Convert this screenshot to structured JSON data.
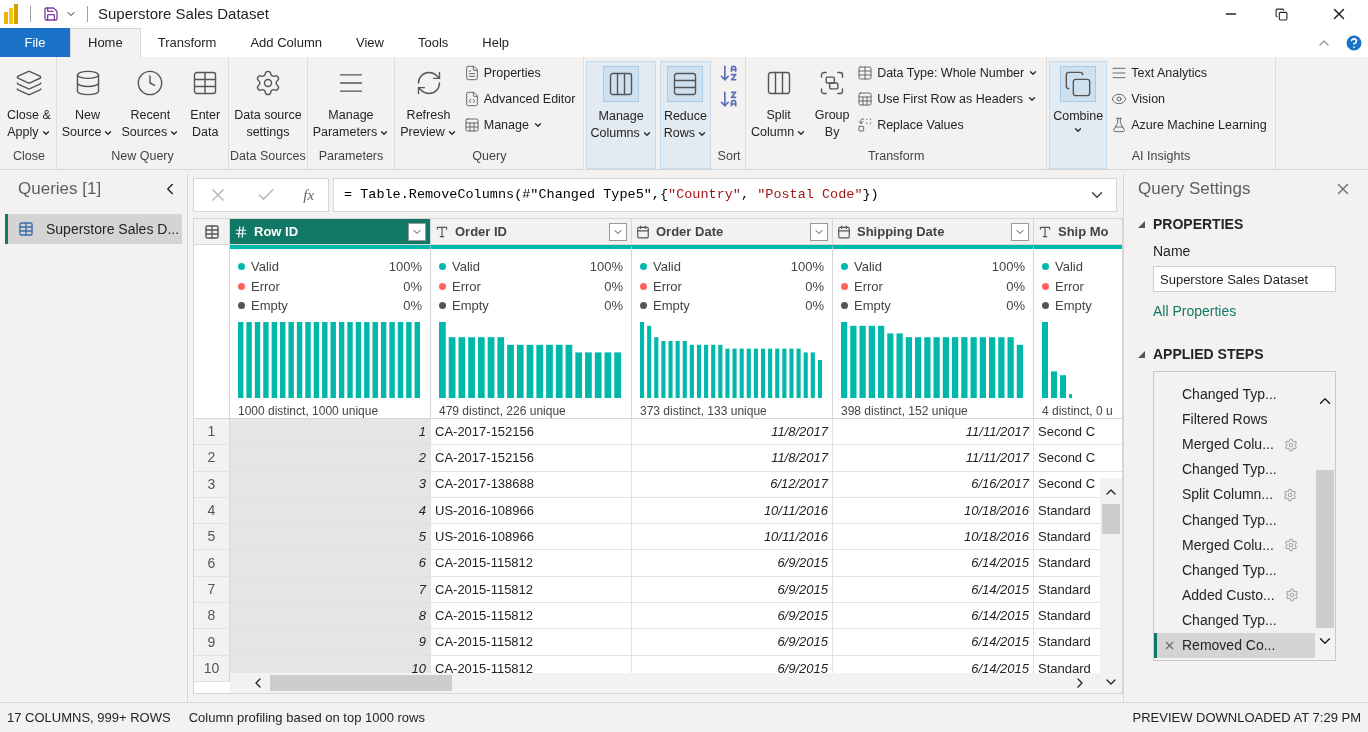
{
  "title_bar": {
    "title": "Superstore Sales Dataset"
  },
  "menu_tabs": [
    {
      "label": "File",
      "kind": "file",
      "selected": false
    },
    {
      "label": "Home",
      "kind": "tab",
      "selected": true
    },
    {
      "label": "Transform",
      "kind": "tab",
      "selected": false
    },
    {
      "label": "Add Column",
      "kind": "tab",
      "selected": false
    },
    {
      "label": "View",
      "kind": "tab",
      "selected": false
    },
    {
      "label": "Tools",
      "kind": "tab",
      "selected": false
    },
    {
      "label": "Help",
      "kind": "tab",
      "selected": false
    }
  ],
  "ribbon": [
    {
      "label": "Close",
      "items": [
        {
          "kind": "large",
          "lines": [
            "Close &",
            "Apply"
          ],
          "dropdown": true,
          "highlighted": false
        }
      ]
    },
    {
      "label": "New Query",
      "items": [
        {
          "kind": "large",
          "lines": [
            "New",
            "Source"
          ],
          "dropdown": true,
          "highlighted": false
        },
        {
          "kind": "large",
          "lines": [
            "Recent",
            "Sources"
          ],
          "dropdown": true,
          "highlighted": false
        },
        {
          "kind": "large",
          "lines": [
            "Enter",
            "Data"
          ],
          "dropdown": false,
          "highlighted": false
        }
      ]
    },
    {
      "label": "Data Sources",
      "items": [
        {
          "kind": "large",
          "lines": [
            "Data source",
            "settings"
          ],
          "dropdown": false,
          "highlighted": false
        }
      ]
    },
    {
      "label": "Parameters",
      "items": [
        {
          "kind": "large",
          "lines": [
            "Manage",
            "Parameters"
          ],
          "dropdown": true,
          "highlighted": false
        }
      ]
    },
    {
      "label": "Query",
      "items": [
        {
          "kind": "large",
          "lines": [
            "Refresh",
            "Preview"
          ],
          "dropdown": true,
          "highlighted": false
        },
        {
          "kind": "small",
          "lines": [
            "Properties"
          ],
          "dropdown": false
        },
        {
          "kind": "small",
          "lines": [
            "Advanced Editor"
          ],
          "dropdown": false
        },
        {
          "kind": "small",
          "lines": [
            "Manage"
          ],
          "dropdown": true
        }
      ]
    },
    {
      "items": [
        {
          "kind": "large",
          "lines": [
            "Manage",
            "Columns"
          ],
          "dropdown": true,
          "highlighted": true
        }
      ]
    },
    {
      "items": [
        {
          "kind": "large",
          "lines": [
            "Reduce",
            "Rows"
          ],
          "dropdown": true,
          "highlighted": true
        }
      ]
    },
    {
      "label": "Sort",
      "items": [
        {
          "kind": "icon"
        },
        {
          "kind": "icon"
        }
      ]
    },
    {
      "label": "Transform",
      "items": [
        {
          "kind": "large",
          "lines": [
            "Split",
            "Column"
          ],
          "dropdown": true,
          "highlighted": false
        },
        {
          "kind": "large",
          "lines": [
            "Group",
            "By"
          ],
          "dropdown": false,
          "highlighted": false
        },
        {
          "kind": "small",
          "lines": [
            "Data Type: Whole Number"
          ],
          "dropdown": true
        },
        {
          "kind": "small",
          "lines": [
            "Use First Row as Headers"
          ],
          "dropdown": true
        },
        {
          "kind": "small",
          "lines": [
            "Replace Values"
          ],
          "dropdown": false
        }
      ]
    },
    {
      "label": "AI Insights",
      "items": [
        {
          "kind": "large",
          "lines": [
            "Combine"
          ],
          "dropdown": true,
          "highlighted": true
        },
        {
          "kind": "small",
          "lines": [
            "Text Analytics"
          ],
          "dropdown": false
        },
        {
          "kind": "small",
          "lines": [
            "Vision"
          ],
          "dropdown": false
        },
        {
          "kind": "small",
          "lines": [
            "Azure Machine Learning"
          ],
          "dropdown": false
        }
      ]
    }
  ],
  "queries_pane": {
    "title": "Queries [1]",
    "items": [
      {
        "label": "Superstore Sales D...",
        "selected": true
      }
    ]
  },
  "formula_bar": {
    "fx_label": "fx",
    "parts": [
      {
        "text": "= Table.RemoveColumns(#\"Changed Type5\",{",
        "kind": "code"
      },
      {
        "text": "\"Country\"",
        "kind": "string"
      },
      {
        "text": ", ",
        "kind": "code"
      },
      {
        "text": "\"Postal Code\"",
        "kind": "string"
      },
      {
        "text": "})",
        "kind": "code"
      }
    ]
  },
  "table": {
    "columns": [
      {
        "name": "Row ID",
        "kind": "number",
        "selected": true,
        "valid_label": "Valid",
        "valid": "100%",
        "error_label": "Error",
        "error": "0%",
        "empty_label": "Empty",
        "empty": "0%",
        "distinct": "1000 distinct, 1000 unique"
      },
      {
        "name": "Order ID",
        "kind": "text",
        "selected": false,
        "valid_label": "Valid",
        "valid": "100%",
        "error_label": "Error",
        "error": "0%",
        "empty_label": "Empty",
        "empty": "0%",
        "distinct": "479 distinct, 226 unique"
      },
      {
        "name": "Order Date",
        "kind": "date",
        "selected": false,
        "valid_label": "Valid",
        "valid": "100%",
        "error_label": "Error",
        "error": "0%",
        "empty_label": "Empty",
        "empty": "0%",
        "distinct": "373 distinct, 133 unique"
      },
      {
        "name": "Shipping Date",
        "kind": "date",
        "selected": false,
        "valid_label": "Valid",
        "valid": "100%",
        "error_label": "Error",
        "error": "0%",
        "empty_label": "Empty",
        "empty": "0%",
        "distinct": "398 distinct, 152 unique"
      },
      {
        "name": "Ship Mo",
        "kind": "text",
        "selected": false,
        "valid_label": "Valid",
        "error_label": "Error",
        "empty_label": "Empty",
        "distinct": "4 distinct, 0 u"
      }
    ],
    "rows": [
      {
        "number": "1",
        "cells": [
          "1",
          "CA-2017-152156",
          "11/8/2017",
          "11/11/2017",
          "Second C"
        ]
      },
      {
        "number": "2",
        "cells": [
          "2",
          "CA-2017-152156",
          "11/8/2017",
          "11/11/2017",
          "Second C"
        ]
      },
      {
        "number": "3",
        "cells": [
          "3",
          "CA-2017-138688",
          "6/12/2017",
          "6/16/2017",
          "Second C"
        ]
      },
      {
        "number": "4",
        "cells": [
          "4",
          "US-2016-108966",
          "10/11/2016",
          "10/18/2016",
          "Standard"
        ]
      },
      {
        "number": "5",
        "cells": [
          "5",
          "US-2016-108966",
          "10/11/2016",
          "10/18/2016",
          "Standard"
        ]
      },
      {
        "number": "6",
        "cells": [
          "6",
          "CA-2015-115812",
          "6/9/2015",
          "6/14/2015",
          "Standard"
        ]
      },
      {
        "number": "7",
        "cells": [
          "7",
          "CA-2015-115812",
          "6/9/2015",
          "6/14/2015",
          "Standard"
        ]
      },
      {
        "number": "8",
        "cells": [
          "8",
          "CA-2015-115812",
          "6/9/2015",
          "6/14/2015",
          "Standard"
        ]
      },
      {
        "number": "9",
        "cells": [
          "9",
          "CA-2015-115812",
          "6/9/2015",
          "6/14/2015",
          "Standard"
        ]
      },
      {
        "number": "10",
        "cells": [
          "10",
          "CA-2015-115812",
          "6/9/2015",
          "6/14/2015",
          "Standard"
        ]
      }
    ]
  },
  "query_settings": {
    "title": "Query Settings",
    "properties_heading": "PROPERTIES",
    "name_label": "Name",
    "name_value": "Superstore Sales Dataset",
    "all_properties_link": "All Properties",
    "steps_heading": "APPLIED STEPS",
    "steps": [
      {
        "label": "Changed Typ...",
        "has_settings": false,
        "selected": false
      },
      {
        "label": "Filtered Rows",
        "has_settings": false,
        "selected": false
      },
      {
        "label": "Merged Colu...",
        "has_settings": true,
        "selected": false
      },
      {
        "label": "Changed Typ...",
        "has_settings": false,
        "selected": false
      },
      {
        "label": "Split Column...",
        "has_settings": true,
        "selected": false
      },
      {
        "label": "Changed Typ...",
        "has_settings": false,
        "selected": false
      },
      {
        "label": "Merged Colu...",
        "has_settings": true,
        "selected": false
      },
      {
        "label": "Changed Typ...",
        "has_settings": false,
        "selected": false
      },
      {
        "label": "Added Custo...",
        "has_settings": true,
        "selected": false
      },
      {
        "label": "Changed Typ...",
        "has_settings": false,
        "selected": false
      },
      {
        "label": "Removed Co...",
        "has_settings": false,
        "selected": true
      }
    ]
  },
  "status_bar": {
    "left": [
      "17 COLUMNS, 999+ ROWS",
      "Column profiling based on top 1000 rows"
    ],
    "right": "PREVIEW DOWNLOADED AT 7:29 PM"
  }
}
